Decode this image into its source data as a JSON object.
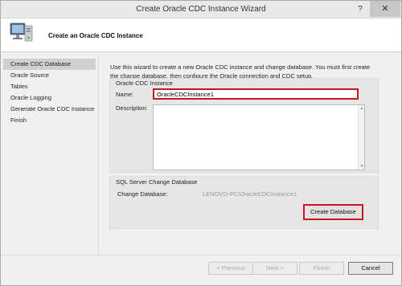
{
  "window": {
    "title": "Create Oracle CDC Instance Wizard",
    "help_label": "?",
    "close_label": "✕"
  },
  "header": {
    "title": "Create an Oracle CDC Instance",
    "icon": "computer-icon"
  },
  "nav": {
    "items": [
      {
        "label": "Create CDC Database",
        "active": true
      },
      {
        "label": "Oracle Source",
        "active": false
      },
      {
        "label": "Tables",
        "active": false
      },
      {
        "label": "Oracle Logging",
        "active": false
      },
      {
        "label": "Generate Oracle CDC Instance",
        "active": false
      },
      {
        "label": "Finish",
        "active": false
      }
    ]
  },
  "main": {
    "intro": "Use this wizard to create a new Oracle CDC instance and change database. You must first create the change database, then configure the Oracle connection and CDC setup.",
    "instance_group": {
      "title": "Oracle CDC Instance",
      "name_label": "Name:",
      "name_value": "OracleCDCInstance1",
      "description_label": "Description:",
      "description_value": ""
    },
    "change_db_group": {
      "title": "SQL Server Change Database",
      "change_db_label": "Change Database:",
      "change_db_value": "LENOVO-PC\\OracleCDCInstance1",
      "create_button": "Create Database"
    }
  },
  "footer": {
    "previous": "< Previous",
    "next": "Next >",
    "finish": "Finish",
    "cancel": "Cancel"
  },
  "colors": {
    "highlight_border": "#c8161e",
    "active_nav": "#cfcfcf"
  }
}
